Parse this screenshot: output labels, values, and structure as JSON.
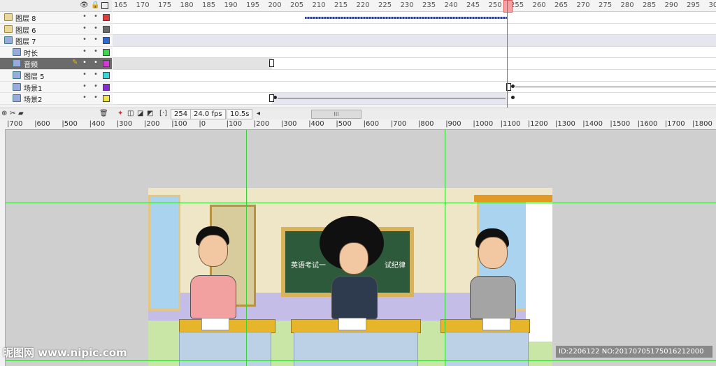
{
  "timeline": {
    "frame_numbers": [
      "165",
      "170",
      "175",
      "180",
      "185",
      "190",
      "195",
      "200",
      "205",
      "210",
      "215",
      "220",
      "225",
      "230",
      "235",
      "240",
      "245",
      "250",
      "255",
      "260",
      "265",
      "270",
      "275",
      "280",
      "285",
      "290",
      "295",
      "30"
    ],
    "layers": [
      {
        "name": "图层 8",
        "type": "folder",
        "color": "#e23b3b",
        "selected": false
      },
      {
        "name": "图层 6",
        "type": "folder",
        "color": "#6a6a6a",
        "selected": false
      },
      {
        "name": "图层 7",
        "type": "symbol",
        "color": "#2e6ad6",
        "selected": false
      },
      {
        "name": "时长",
        "type": "symbol",
        "color": "#3ad64d",
        "selected": false
      },
      {
        "name": "音频",
        "type": "symbol",
        "color": "#d63ad6",
        "selected": true
      },
      {
        "name": "图层 5",
        "type": "symbol",
        "color": "#3ad6d6",
        "selected": false
      },
      {
        "name": "场景1",
        "type": "symbol",
        "color": "#8a2ad6",
        "selected": false
      },
      {
        "name": "场景2",
        "type": "symbol",
        "color": "#f0e44a",
        "selected": false
      }
    ],
    "footer": {
      "current_frame": "254",
      "fps": "24.0 fps",
      "time": "10.5s"
    }
  },
  "stage": {
    "ruler_numbers": [
      "700",
      "600",
      "500",
      "400",
      "300",
      "200",
      "100",
      "0",
      "100",
      "200",
      "300",
      "400",
      "500",
      "600",
      "700",
      "800",
      "900",
      "1000",
      "1100",
      "1200",
      "1300",
      "1400",
      "1500",
      "1600",
      "1700",
      "1800"
    ],
    "board_text_left": "英语考试一",
    "board_text_right": "试纪律"
  },
  "watermark": {
    "left": "昵图网 www.nipic.com",
    "right": "ID:2206122 NO:20170705175016212000"
  }
}
